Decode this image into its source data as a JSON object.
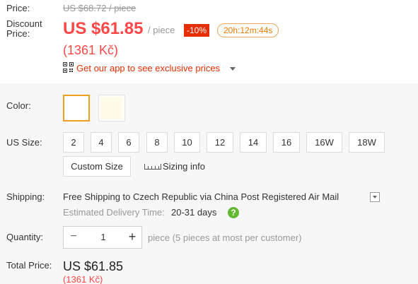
{
  "price": {
    "label": "Price:",
    "original": "US $68.72 / piece",
    "discount_label_line1": "Discount",
    "discount_label_line2": "Price:",
    "discounted": "US $61.85",
    "per_piece": "/ piece",
    "discount_badge": "-10%",
    "countdown": "20h:12m:44s",
    "local_price": "(1361 Kč)",
    "app_promo": "Get our app to see exclusive prices"
  },
  "color": {
    "label": "Color:",
    "options": [
      "white",
      "beige"
    ],
    "selected_index": 0,
    "swatch_colors": [
      "#ffffff",
      "#fffbe8"
    ]
  },
  "size": {
    "label": "US Size:",
    "options": [
      "2",
      "4",
      "6",
      "8",
      "10",
      "12",
      "14",
      "16",
      "16W",
      "18W"
    ],
    "custom_label": "Custom Size",
    "sizing_info_label": "Sizing info"
  },
  "shipping": {
    "label": "Shipping:",
    "text": "Free Shipping to Czech Republic via China Post Registered Air Mail",
    "estimated_label": "Estimated Delivery Time:",
    "estimated_value": "20-31 days"
  },
  "quantity": {
    "label": "Quantity:",
    "value": "1",
    "minus": "−",
    "plus": "+",
    "note": "piece (5 pieces at most per customer)"
  },
  "total": {
    "label": "Total Price:",
    "value": "US $61.85",
    "local_value": "(1361 Kč)"
  },
  "colors": {
    "accent_red": "#ff4747",
    "badge_red": "#e62e04",
    "timer_orange": "#e77a00",
    "selected_border": "#f0a020",
    "help_green": "#62b830"
  }
}
